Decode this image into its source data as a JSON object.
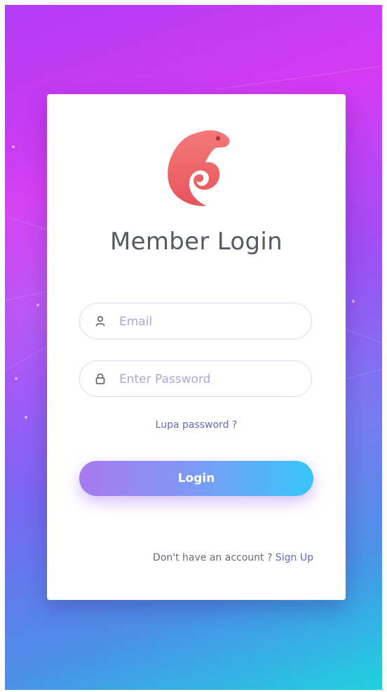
{
  "login": {
    "title": "Member Login",
    "email_placeholder": "Email",
    "password_placeholder": "Enter Password",
    "forgot_label": "Lupa password ?",
    "login_label": "Login",
    "signup_prompt": "Don't have an account ?",
    "signup_label": "Sign Up"
  },
  "icons": {
    "logo": "chameleon-logo-icon",
    "email": "user-icon",
    "password": "lock-icon"
  },
  "colors": {
    "accent": "#5f6bb8",
    "logo": "#f0636a",
    "button_start": "#a779f0",
    "button_end": "#36c5f8"
  }
}
